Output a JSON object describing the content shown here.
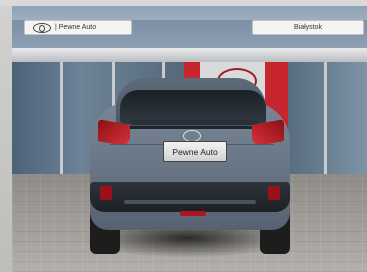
{
  "overlay": {
    "dealer_label": "| Pewne Auto",
    "city_label": "Białystok"
  },
  "car": {
    "plate_text": "Pewne Auto"
  }
}
